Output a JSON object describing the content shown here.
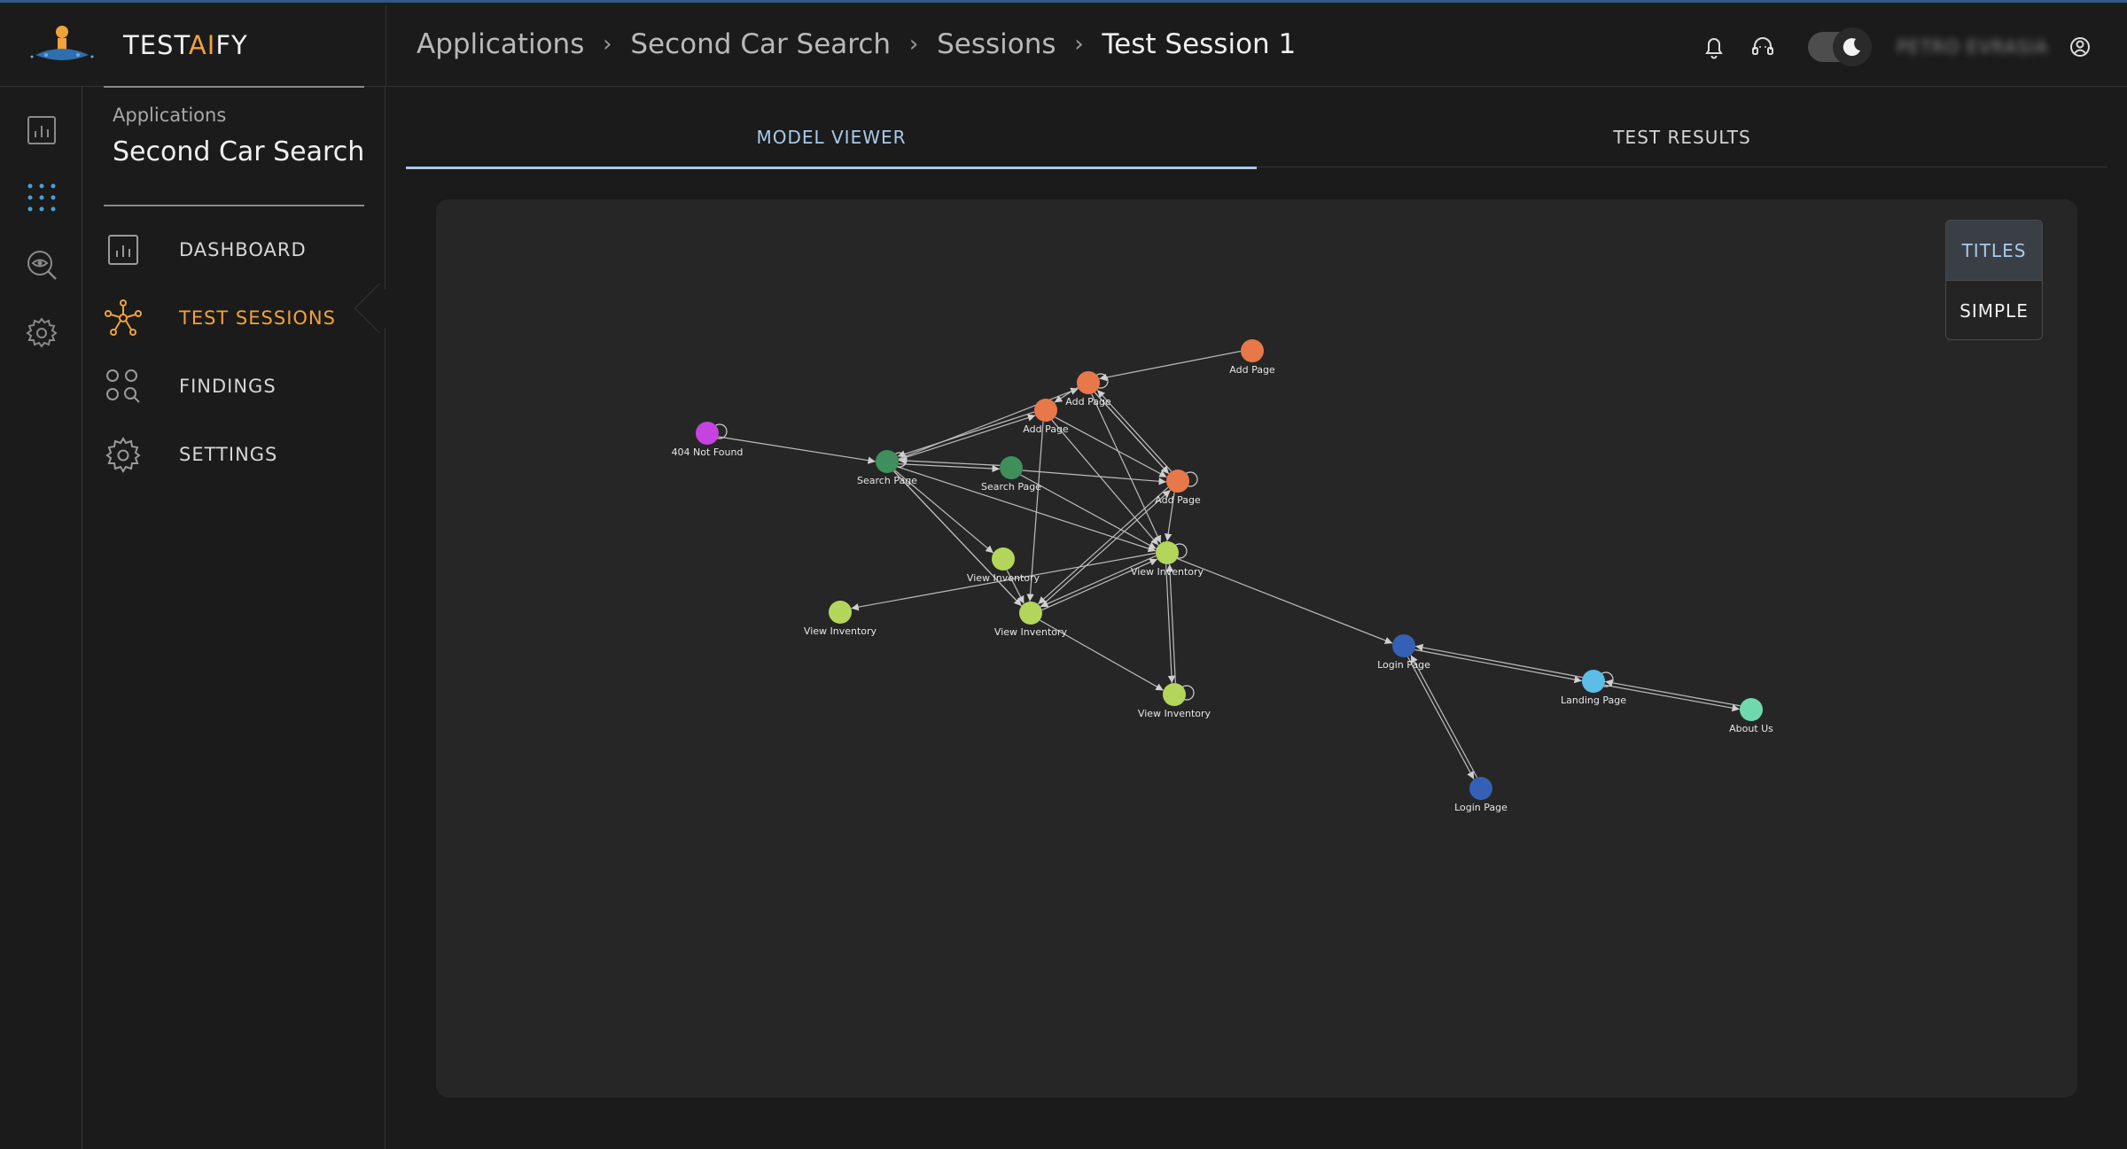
{
  "brand": {
    "prefix": "TEST",
    "ai": "AI",
    "suffix": "FY"
  },
  "breadcrumb": [
    "Applications",
    "Second Car Search",
    "Sessions",
    "Test Session 1"
  ],
  "user": {
    "name": "PETRO EVRASIA"
  },
  "subnav": {
    "app_label": "Applications",
    "app_name": "Second Car Search",
    "items": [
      {
        "label": "DASHBOARD",
        "icon": "dashboard-icon",
        "active": false
      },
      {
        "label": "TEST SESSIONS",
        "icon": "network-icon",
        "active": true
      },
      {
        "label": "FINDINGS",
        "icon": "findings-icon",
        "active": false
      },
      {
        "label": "SETTINGS",
        "icon": "gear-icon",
        "active": false
      }
    ]
  },
  "tabs": [
    {
      "label": "MODEL VIEWER",
      "active": true
    },
    {
      "label": "TEST RESULTS",
      "active": false
    }
  ],
  "view_toggle": {
    "titles": "TITLES",
    "simple": "SIMPLE"
  },
  "colors": {
    "accent": "#f0a23b",
    "tab_active": "#a9c9ea",
    "orange": "#e8784a",
    "green_dark": "#3e8f5c",
    "green_light": "#b3d65a",
    "blue_dark": "#3461b5",
    "blue_light": "#5bbde8",
    "mint": "#6fd9ad",
    "purple": "#c544e0"
  },
  "graph": {
    "nodes": [
      {
        "id": "n404",
        "label": "404 Not Found",
        "color": "#c544e0"
      },
      {
        "id": "s1",
        "label": "Search Page",
        "color": "#3e8f5c"
      },
      {
        "id": "s2",
        "label": "Search Page",
        "color": "#3e8f5c"
      },
      {
        "id": "a1",
        "label": "Add Page",
        "color": "#e8784a"
      },
      {
        "id": "a2",
        "label": "Add Page",
        "color": "#e8784a"
      },
      {
        "id": "a3",
        "label": "Add Page",
        "color": "#e8784a"
      },
      {
        "id": "a4",
        "label": "Add Page",
        "color": "#e8784a"
      },
      {
        "id": "v1",
        "label": "View Inventory",
        "color": "#b3d65a"
      },
      {
        "id": "v2",
        "label": "View Inventory",
        "color": "#b3d65a"
      },
      {
        "id": "v3",
        "label": "View Inventory",
        "color": "#b3d65a"
      },
      {
        "id": "v4",
        "label": "View Inventory",
        "color": "#b3d65a"
      },
      {
        "id": "v5",
        "label": "View Inventory",
        "color": "#b3d65a"
      },
      {
        "id": "l1",
        "label": "Login Page",
        "color": "#3461b5"
      },
      {
        "id": "l2",
        "label": "Login Page",
        "color": "#3461b5"
      },
      {
        "id": "land",
        "label": "Landing Page",
        "color": "#5bbde8"
      },
      {
        "id": "about",
        "label": "About Us",
        "color": "#6fd9ad"
      }
    ],
    "edges": [
      [
        "n404",
        "s1"
      ],
      [
        "s1",
        "s2"
      ],
      [
        "s2",
        "s1"
      ],
      [
        "s1",
        "a1"
      ],
      [
        "a1",
        "s1"
      ],
      [
        "s1",
        "a2"
      ],
      [
        "a2",
        "a3"
      ],
      [
        "a3",
        "a2"
      ],
      [
        "s1",
        "v1"
      ],
      [
        "s1",
        "v2"
      ],
      [
        "s1",
        "v3"
      ],
      [
        "s2",
        "a3"
      ],
      [
        "s2",
        "v2"
      ],
      [
        "a1",
        "a3"
      ],
      [
        "a1",
        "v2"
      ],
      [
        "a2",
        "a1"
      ],
      [
        "a2",
        "v2"
      ],
      [
        "a3",
        "v2"
      ],
      [
        "a3",
        "v3"
      ],
      [
        "a2",
        "a3"
      ],
      [
        "a1",
        "v3"
      ],
      [
        "v3",
        "v2"
      ],
      [
        "v1",
        "v3"
      ],
      [
        "v3",
        "a3"
      ],
      [
        "v2",
        "v4"
      ],
      [
        "v2",
        "v5"
      ],
      [
        "v5",
        "v2"
      ],
      [
        "v2",
        "l1"
      ],
      [
        "l1",
        "l2"
      ],
      [
        "l2",
        "l1"
      ],
      [
        "l1",
        "land"
      ],
      [
        "land",
        "l1"
      ],
      [
        "land",
        "about"
      ],
      [
        "about",
        "land"
      ],
      [
        "v3",
        "v5"
      ],
      [
        "v2",
        "v3"
      ],
      [
        "s1",
        "v3"
      ],
      [
        "a4",
        "a2"
      ]
    ],
    "self_loops": [
      "n404",
      "s1",
      "a2",
      "a3",
      "v2",
      "v5",
      "land"
    ]
  }
}
